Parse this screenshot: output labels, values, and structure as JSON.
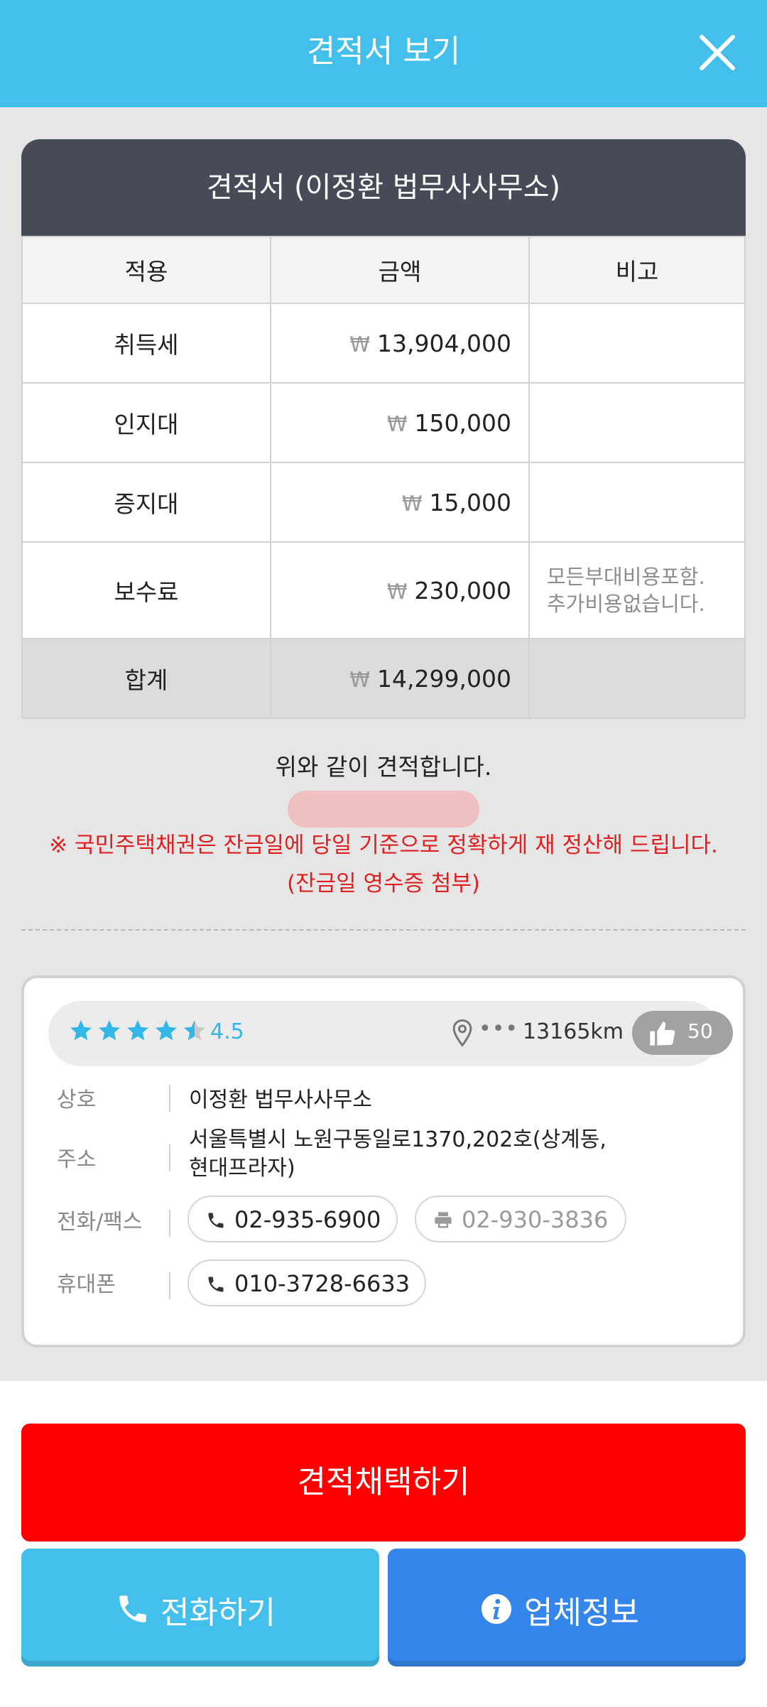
{
  "appbar": {
    "title": "견적서 보기"
  },
  "quote": {
    "title": "견적서 (이정환 법무사사무소)",
    "columns": [
      "적용",
      "금액",
      "비고"
    ],
    "currency": "₩",
    "rows": [
      {
        "name": "취득세",
        "amount": "13,904,000",
        "note": ""
      },
      {
        "name": "인지대",
        "amount": "150,000",
        "note": ""
      },
      {
        "name": "증지대",
        "amount": "15,000",
        "note": ""
      },
      {
        "name": "보수료",
        "amount": "230,000",
        "note_line1": "모든부대비용포함.",
        "note_line2": "추가비용없습니다."
      }
    ],
    "total": {
      "name": "합계",
      "amount": "14,299,000"
    }
  },
  "statement": "위와 같이 견적합니다.",
  "notice": {
    "line1": "※ 국민주택채권은 잔금일에 당일 기준으로 정확하게 재 정산해 드립니다.",
    "line2": "(잔금일 영수증 첨부)"
  },
  "office": {
    "rating": "4.5",
    "distance": "13165km",
    "likes": "50",
    "labels": {
      "name": "상호",
      "address": "주소",
      "phone_fax": "전화/팩스",
      "mobile": "휴대폰"
    },
    "name": "이정환 법무사사무소",
    "address_line1": "서울특별시 노원구동일로1370,202호(상계동,",
    "address_line2": "현대프라자)",
    "phone": "02-935-6900",
    "fax": "02-930-3836",
    "mobile": "010-3728-6633"
  },
  "buttons": {
    "accept": "견적채택하기",
    "call": "전화하기",
    "company_info": "업체정보"
  },
  "colors": {
    "header": "#43bfec",
    "accept": "#ff0000",
    "call": "#43bfec",
    "info": "#3586ea",
    "table_head": "#474b57",
    "notice": "#e02020"
  }
}
